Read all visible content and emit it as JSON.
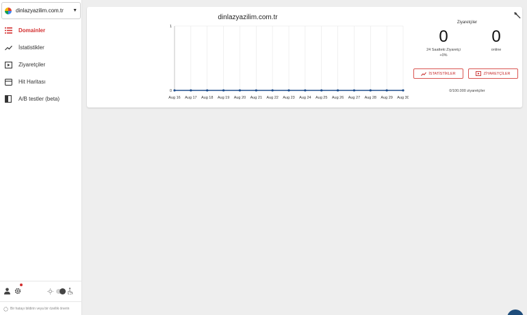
{
  "sidebar": {
    "site_select": {
      "label": "dinlazyazilim.com.tr"
    },
    "items": [
      {
        "label": "Domainler",
        "icon": "list-icon",
        "active": true
      },
      {
        "label": "İstatistikler",
        "icon": "trend-icon",
        "active": false
      },
      {
        "label": "Ziyaretçiler",
        "icon": "play-box-icon",
        "active": false
      },
      {
        "label": "Hit Haritası",
        "icon": "map-icon",
        "active": false
      },
      {
        "label": "A/B testler (beta)",
        "icon": "split-test-icon",
        "active": false
      }
    ],
    "footer_text": "Bir hatayı bildirin veya bir özellik önerin"
  },
  "card": {
    "chart_title": "dinlazyazilim.com.tr",
    "stats": {
      "title": "Ziyaretçiler",
      "visitors_24h": "0",
      "visitors_24h_label": "24 Saatteki Ziyaretçi",
      "change": "+0%",
      "online": "0",
      "online_label": "online",
      "btn_stats": "İSTATİSTİKLER",
      "btn_visitors": "ZİYARETÇİLER",
      "quota": "0/100.000 ziyaretçiler"
    }
  },
  "colors": {
    "accent": "#d32f2f",
    "line": "#1e4d8c",
    "fab": "#1e4d7b"
  },
  "chart_data": {
    "type": "line",
    "title": "dinlazyazilim.com.tr",
    "x": [
      "Aug 16",
      "Aug 17",
      "Aug 18",
      "Aug 19",
      "Aug 20",
      "Aug 21",
      "Aug 22",
      "Aug 23",
      "Aug 24",
      "Aug 25",
      "Aug 26",
      "Aug 27",
      "Aug 28",
      "Aug 29",
      "Aug 30"
    ],
    "series": [
      {
        "values": [
          0,
          0,
          0,
          0,
          0,
          0,
          0,
          0,
          0,
          0,
          0,
          0,
          0,
          0,
          0
        ]
      }
    ],
    "ylim": [
      0,
      1
    ],
    "yticks": [
      0,
      1
    ],
    "grid": true
  }
}
